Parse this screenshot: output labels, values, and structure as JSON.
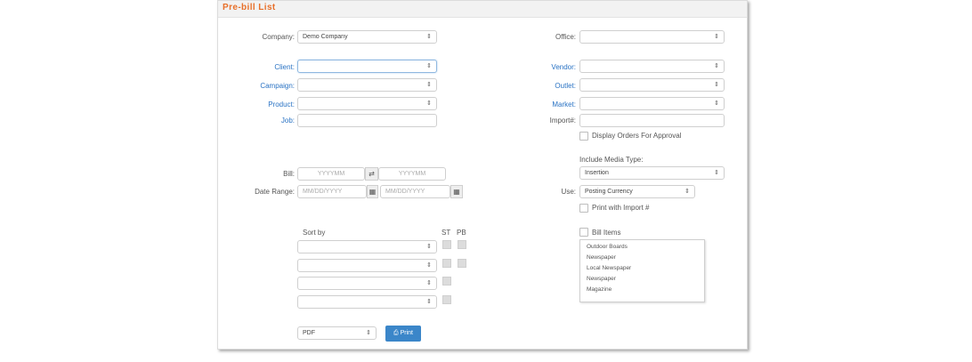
{
  "header": {
    "title": "Pre-bill List"
  },
  "fields": {
    "company": {
      "label": "Company:",
      "value": "Demo Company"
    },
    "office": {
      "label": "Office:",
      "value": ""
    },
    "client": {
      "label": "Client:",
      "value": ""
    },
    "campaign": {
      "label": "Campaign:",
      "value": ""
    },
    "product": {
      "label": "Product:",
      "value": ""
    },
    "job": {
      "label": "Job:",
      "value": ""
    },
    "vendor": {
      "label": "Vendor:",
      "value": ""
    },
    "outlet": {
      "label": "Outlet:",
      "value": ""
    },
    "market": {
      "label": "Market:",
      "value": ""
    },
    "import": {
      "label": "Import#:",
      "value": ""
    },
    "bill": {
      "label": "Bill:",
      "from_placeholder": "YYYYMM",
      "to_placeholder": "YYYYMM",
      "swap_icon": "swap-arrows-icon"
    },
    "date_range": {
      "label": "Date Range:",
      "from_placeholder": "MM/DD/YYYY",
      "to_placeholder": "MM/DD/YYYY",
      "calendar_icon": "calendar-icon"
    },
    "include_media_type": {
      "label": "Include Media Type:",
      "value": "Insertion"
    },
    "use": {
      "label": "Use:",
      "value": "Posting Currency"
    }
  },
  "checkboxes": {
    "display_orders": {
      "label": "Display Orders For Approval",
      "checked": false
    },
    "print_import": {
      "label": "Print with Import #",
      "checked": false
    },
    "bill_items": {
      "label": "Bill Items",
      "checked": false
    }
  },
  "sort": {
    "label": "Sort by",
    "col_st": "ST",
    "col_pb": "PB",
    "rows": [
      {
        "value": "",
        "st": false,
        "pb": false
      },
      {
        "value": "",
        "st": false,
        "pb": false
      },
      {
        "value": "",
        "st": false
      },
      {
        "value": "",
        "st": false
      }
    ]
  },
  "bill_items_list": [
    "Outdoor Boards",
    "Newspaper",
    "Local Newspaper",
    "Newspaper",
    "Magazine"
  ],
  "output": {
    "format": "PDF",
    "print_label": "Print",
    "print_icon": "printer-icon"
  },
  "colors": {
    "title": "#e8702a",
    "link_label": "#2a73c4",
    "button": "#3b86c9"
  }
}
